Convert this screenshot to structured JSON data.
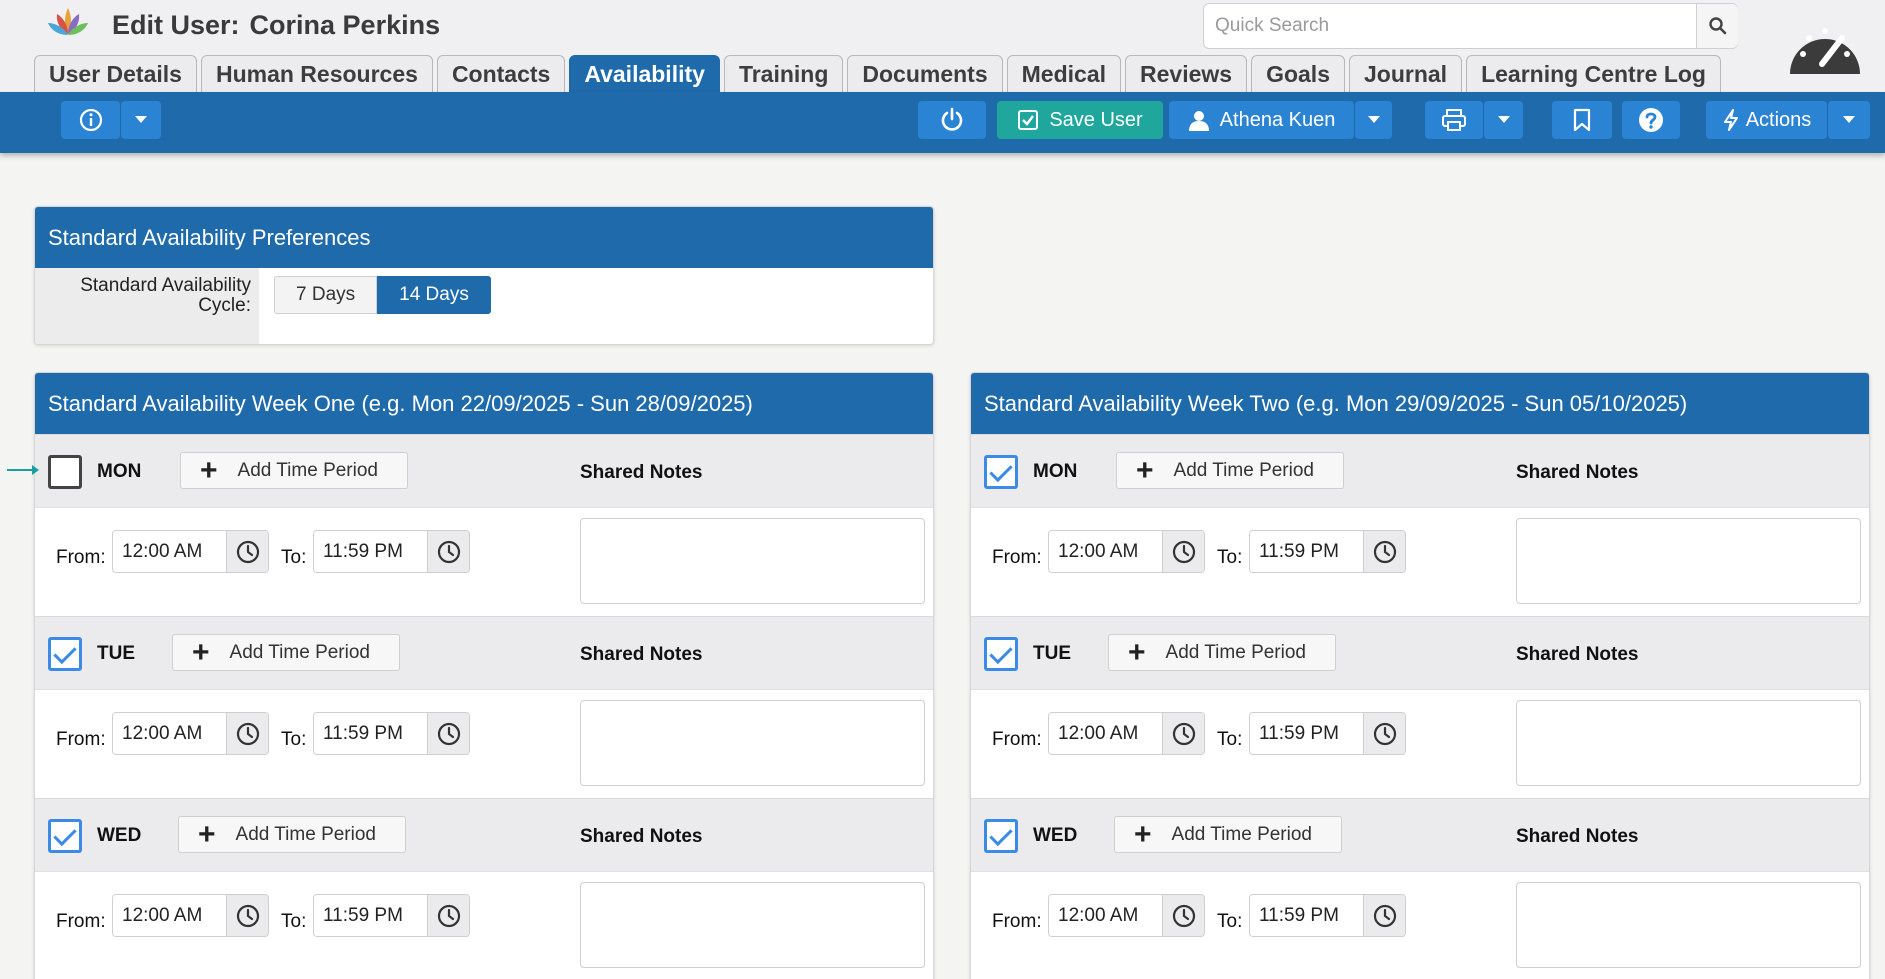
{
  "header": {
    "title_prefix": "Edit User:",
    "user_name": "Corina Perkins",
    "search_placeholder": "Quick Search"
  },
  "tabs": [
    {
      "label": "User Details",
      "active": false
    },
    {
      "label": "Human Resources",
      "active": false
    },
    {
      "label": "Contacts",
      "active": false
    },
    {
      "label": "Availability",
      "active": true
    },
    {
      "label": "Training",
      "active": false
    },
    {
      "label": "Documents",
      "active": false
    },
    {
      "label": "Medical",
      "active": false
    },
    {
      "label": "Reviews",
      "active": false
    },
    {
      "label": "Goals",
      "active": false
    },
    {
      "label": "Journal",
      "active": false
    },
    {
      "label": "Learning Centre Log",
      "active": false
    }
  ],
  "toolbar": {
    "save_label": "Save User",
    "user_label": "Athena Kuen",
    "actions_label": "Actions"
  },
  "preferences": {
    "title": "Standard Availability Preferences",
    "cycle_label": "Standard Availability Cycle:",
    "options": [
      "7 Days",
      "14 Days"
    ],
    "selected": "14 Days"
  },
  "weeks": [
    {
      "title": "Standard Availability Week One (e.g. Mon 22/09/2025 - Sun 28/09/2025)",
      "days": [
        {
          "name": "MON",
          "checked": false,
          "from": "12:00 AM",
          "to": "11:59 PM"
        },
        {
          "name": "TUE",
          "checked": true,
          "from": "12:00 AM",
          "to": "11:59 PM"
        },
        {
          "name": "WED",
          "checked": true,
          "from": "12:00 AM",
          "to": "11:59 PM"
        }
      ]
    },
    {
      "title": "Standard Availability Week Two (e.g. Mon 29/09/2025 - Sun 05/10/2025)",
      "days": [
        {
          "name": "MON",
          "checked": true,
          "from": "12:00 AM",
          "to": "11:59 PM"
        },
        {
          "name": "TUE",
          "checked": true,
          "from": "12:00 AM",
          "to": "11:59 PM"
        },
        {
          "name": "WED",
          "checked": true,
          "from": "12:00 AM",
          "to": "11:59 PM"
        }
      ]
    }
  ],
  "labels": {
    "add_time_period": "Add Time Period",
    "shared_notes": "Shared Notes",
    "from": "From:",
    "to": "To:"
  },
  "colors": {
    "primary": "#1f6aab",
    "button_blue": "#2b83d3",
    "save_green": "#1fa79d",
    "checkbox_blue": "#3a8ae6",
    "marker_arrow": "#1a9fa0"
  },
  "icons": [
    "lotus-logo-icon",
    "search-icon",
    "dashboard-gauge-icon",
    "info-icon",
    "caret-down-icon",
    "power-icon",
    "check-square-icon",
    "user-icon",
    "printer-icon",
    "bookmark-icon",
    "help-icon",
    "bolt-icon",
    "plus-icon",
    "clock-icon"
  ]
}
